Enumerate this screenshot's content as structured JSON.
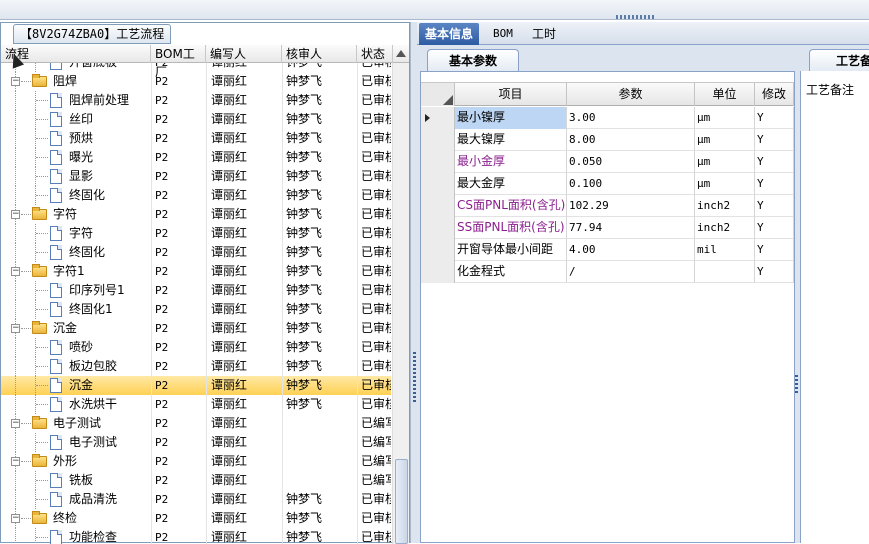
{
  "window_title": "【8V2G74ZBA0】工艺流程",
  "tree": {
    "headers": {
      "process": "流程",
      "bom": "BOM工厂",
      "writer": "编写人",
      "checker": "核审人",
      "status": "状态"
    },
    "rows": [
      {
        "label": "开窗底板",
        "level": 2,
        "type": "doc",
        "bom": "P2",
        "writer": "谭丽红",
        "checker": "钟梦飞",
        "status": "已审核"
      },
      {
        "label": "阻焊",
        "level": 1,
        "type": "folder",
        "bom": "P2",
        "writer": "谭丽红",
        "checker": "钟梦飞",
        "status": "已审核"
      },
      {
        "label": "阻焊前处理",
        "level": 2,
        "type": "doc",
        "bom": "P2",
        "writer": "谭丽红",
        "checker": "钟梦飞",
        "status": "已审核"
      },
      {
        "label": "丝印",
        "level": 2,
        "type": "doc",
        "bom": "P2",
        "writer": "谭丽红",
        "checker": "钟梦飞",
        "status": "已审核"
      },
      {
        "label": "预烘",
        "level": 2,
        "type": "doc",
        "bom": "P2",
        "writer": "谭丽红",
        "checker": "钟梦飞",
        "status": "已审核"
      },
      {
        "label": "曝光",
        "level": 2,
        "type": "doc",
        "bom": "P2",
        "writer": "谭丽红",
        "checker": "钟梦飞",
        "status": "已审核"
      },
      {
        "label": "显影",
        "level": 2,
        "type": "doc",
        "bom": "P2",
        "writer": "谭丽红",
        "checker": "钟梦飞",
        "status": "已审核"
      },
      {
        "label": "终固化",
        "level": 2,
        "type": "doc",
        "bom": "P2",
        "writer": "谭丽红",
        "checker": "钟梦飞",
        "status": "已审核"
      },
      {
        "label": "字符",
        "level": 1,
        "type": "folder",
        "bom": "P2",
        "writer": "谭丽红",
        "checker": "钟梦飞",
        "status": "已审核"
      },
      {
        "label": "字符",
        "level": 2,
        "type": "doc",
        "bom": "P2",
        "writer": "谭丽红",
        "checker": "钟梦飞",
        "status": "已审核"
      },
      {
        "label": "终固化",
        "level": 2,
        "type": "doc",
        "bom": "P2",
        "writer": "谭丽红",
        "checker": "钟梦飞",
        "status": "已审核"
      },
      {
        "label": "字符1",
        "level": 1,
        "type": "folder",
        "bom": "P2",
        "writer": "谭丽红",
        "checker": "钟梦飞",
        "status": "已审核"
      },
      {
        "label": "印序列号1",
        "level": 2,
        "type": "doc",
        "bom": "P2",
        "writer": "谭丽红",
        "checker": "钟梦飞",
        "status": "已审核"
      },
      {
        "label": "终固化1",
        "level": 2,
        "type": "doc",
        "bom": "P2",
        "writer": "谭丽红",
        "checker": "钟梦飞",
        "status": "已审核"
      },
      {
        "label": "沉金",
        "level": 1,
        "type": "folder",
        "bom": "P2",
        "writer": "谭丽红",
        "checker": "钟梦飞",
        "status": "已审核"
      },
      {
        "label": "喷砂",
        "level": 2,
        "type": "doc",
        "bom": "P2",
        "writer": "谭丽红",
        "checker": "钟梦飞",
        "status": "已审核"
      },
      {
        "label": "板边包胶",
        "level": 2,
        "type": "doc",
        "bom": "P2",
        "writer": "谭丽红",
        "checker": "钟梦飞",
        "status": "已审核"
      },
      {
        "label": "沉金",
        "level": 2,
        "type": "doc",
        "bom": "P2",
        "writer": "谭丽红",
        "checker": "钟梦飞",
        "status": "已审核",
        "selected": true
      },
      {
        "label": "水洗烘干",
        "level": 2,
        "type": "doc",
        "bom": "P2",
        "writer": "谭丽红",
        "checker": "钟梦飞",
        "status": "已审核"
      },
      {
        "label": "电子测试",
        "level": 1,
        "type": "folder",
        "bom": "P2",
        "writer": "谭丽红",
        "checker": "",
        "status": "已编写"
      },
      {
        "label": "电子测试",
        "level": 2,
        "type": "doc",
        "bom": "P2",
        "writer": "谭丽红",
        "checker": "",
        "status": "已编写"
      },
      {
        "label": "外形",
        "level": 1,
        "type": "folder",
        "bom": "P2",
        "writer": "谭丽红",
        "checker": "",
        "status": "已编写"
      },
      {
        "label": "铣板",
        "level": 2,
        "type": "doc",
        "bom": "P2",
        "writer": "谭丽红",
        "checker": "",
        "status": "已编写"
      },
      {
        "label": "成品清洗",
        "level": 2,
        "type": "doc",
        "bom": "P2",
        "writer": "谭丽红",
        "checker": "钟梦飞",
        "status": "已审核"
      },
      {
        "label": "终检",
        "level": 1,
        "type": "folder",
        "bom": "P2",
        "writer": "谭丽红",
        "checker": "钟梦飞",
        "status": "已审核"
      },
      {
        "label": "功能检查",
        "level": 2,
        "type": "doc",
        "bom": "P2",
        "writer": "谭丽红",
        "checker": "钟梦飞",
        "status": "已审核"
      }
    ]
  },
  "right_tabs": [
    {
      "label": "基本信息",
      "active": true
    },
    {
      "label": "BOM",
      "active": false
    },
    {
      "label": "工时",
      "active": false
    }
  ],
  "subtab_label": "基本参数",
  "subtab2_label": "工艺备",
  "params": {
    "headers": {
      "item": "项目",
      "value": "参数",
      "unit": "单位",
      "mod": "修改"
    },
    "rows": [
      {
        "item": "最小镍厚",
        "value": "3.00",
        "unit": "μm",
        "mod": "Y",
        "current": true,
        "item_style": "blue"
      },
      {
        "item": "最大镍厚",
        "value": "8.00",
        "unit": "μm",
        "mod": "Y"
      },
      {
        "item": "最小金厚",
        "value": "0.050",
        "unit": "μm",
        "mod": "Y",
        "item_style": "purple"
      },
      {
        "item": "最大金厚",
        "value": "0.100",
        "unit": "μm",
        "mod": "Y"
      },
      {
        "item": "CS面PNL面积(含孔)",
        "value": "102.29",
        "unit": "inch2",
        "mod": "Y",
        "item_style": "purple"
      },
      {
        "item": "SS面PNL面积(含孔)",
        "value": "77.94",
        "unit": "inch2",
        "mod": "Y",
        "item_style": "purple"
      },
      {
        "item": "开窗导体最小间距",
        "value": "4.00",
        "unit": "mil",
        "mod": "Y"
      },
      {
        "item": "化金程式",
        "value": "/",
        "unit": "",
        "mod": "Y"
      }
    ]
  },
  "remark_label": "工艺备注"
}
